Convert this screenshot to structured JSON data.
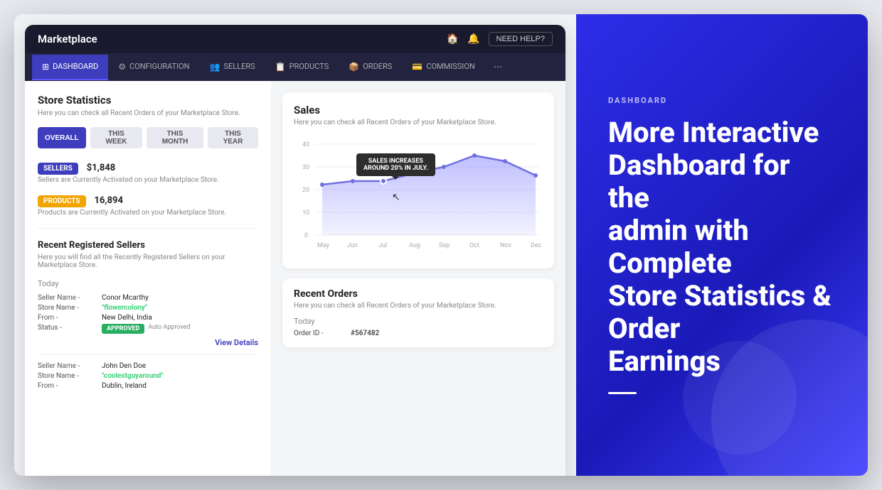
{
  "navbar": {
    "brand": "Marketplace",
    "need_help": "NEED HELP?",
    "home_icon": "🏠",
    "bell_icon": "🔔"
  },
  "subnav": {
    "items": [
      {
        "id": "dashboard",
        "label": "DASHBOARD",
        "active": true,
        "icon": "⊞"
      },
      {
        "id": "configuration",
        "label": "CONFIGURATION",
        "active": false,
        "icon": "⚙"
      },
      {
        "id": "sellers",
        "label": "SELLERS",
        "active": false,
        "icon": "👥"
      },
      {
        "id": "products",
        "label": "PRODUCTS",
        "active": false,
        "icon": "📋"
      },
      {
        "id": "orders",
        "label": "ORDERS",
        "active": false,
        "icon": "📦"
      },
      {
        "id": "commission",
        "label": "COMMISSION",
        "active": false,
        "icon": "💳"
      }
    ],
    "more": "···"
  },
  "store_statistics": {
    "title": "Store Statistics",
    "description": "Here you can check all Recent Orders of your Marketplace Store.",
    "filters": [
      {
        "label": "OVERALL",
        "active": true
      },
      {
        "label": "THIS WEEK",
        "active": false
      },
      {
        "label": "THIS MONTH",
        "active": false
      },
      {
        "label": "THIS YEAR",
        "active": false
      }
    ],
    "stats": [
      {
        "badge": "SELLERS",
        "badge_type": "sellers",
        "value": "$1,848",
        "desc": "Sellers are Currently Activated on your Marketplace Store."
      },
      {
        "badge": "PRODUCTS",
        "badge_type": "products",
        "value": "16,894",
        "desc": "Products are Currently Activated on your Marketplace Store."
      }
    ]
  },
  "recent_sellers": {
    "title": "Recent Registered Sellers",
    "description": "Here you will find all the Recently Registered Sellers on your Marketplace Store.",
    "sellers": [
      {
        "today_label": "Today",
        "name_label": "Seller Name -",
        "name_value": "Conor Mcarthy",
        "store_label": "Store Name -",
        "store_value": "\"flowercolony\"",
        "store_link": true,
        "from_label": "From -",
        "from_value": "New Delhi, India",
        "status_label": "Status -",
        "status_badge": "APPROVED",
        "auto_text": "Auto Approved",
        "view_details": "View Details"
      },
      {
        "today_label": "",
        "name_label": "Seller Name -",
        "name_value": "John Den Doe",
        "store_label": "Store Name -",
        "store_value": "\"coolestguyaround\"",
        "store_link": true,
        "from_label": "From -",
        "from_value": "Dublin, Ireland"
      }
    ]
  },
  "sales_chart": {
    "title": "Sales",
    "description": "Here you can check all Recent Orders of your Marketplace Store.",
    "tooltip": "SALES INCREASES\nAROUND 20% IN JULY.",
    "labels": [
      "May",
      "Jun",
      "Jul",
      "Aug",
      "Sep",
      "Oct",
      "Nov",
      "Dec"
    ],
    "y_labels": [
      "40",
      "30",
      "20",
      "10",
      "0"
    ],
    "data_points": [
      22,
      24,
      24,
      27,
      30,
      35,
      32,
      26
    ]
  },
  "recent_orders": {
    "title": "Recent Orders",
    "description": "Here you can check all Recent Orders of your Marketplace Store.",
    "today_label": "Today",
    "order_id_label": "Order ID -",
    "order_id_value": "#567482"
  },
  "right_panel": {
    "eyebrow": "DASHBOARD",
    "headline_line1": "More Interactive",
    "headline_line2": "Dashboard for the",
    "headline_line3": "admin with Complete",
    "headline_line4": "Store Statistics & Order",
    "headline_line5": "Earnings"
  }
}
